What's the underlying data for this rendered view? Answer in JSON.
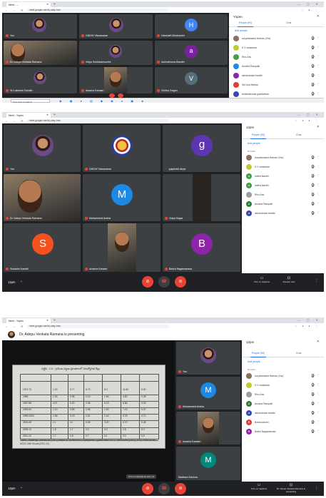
{
  "shot1": {
    "tab_title": "Meet - ...",
    "url": "meet.google.com/bj-ukay-hxw",
    "tiles": [
      {
        "name": "You",
        "kind": "photo"
      },
      {
        "name": "GNDW Viswanaran",
        "kind": "photo"
      },
      {
        "name": "Harshath Deshmukh",
        "kind": "letter",
        "letter": "H",
        "color": "#4285f4"
      },
      {
        "name": "Dr. Adepu Venkata Ramana",
        "kind": "video"
      },
      {
        "name": "Vidya Sekharamoorthi",
        "kind": "photo"
      },
      {
        "name": "Ashhathuma Bandhi",
        "kind": "letter",
        "letter": "a",
        "color": "#7b1fa2"
      },
      {
        "name": "Sri Lakshmi Gandhi",
        "kind": "photo"
      },
      {
        "name": "Anasha Kansari",
        "kind": "video"
      },
      {
        "name": "Vinitha Gagan",
        "kind": "letter",
        "letter": "V",
        "color": "#546e7a"
      }
    ],
    "meeting_time": "",
    "panel": {
      "title": "Yspen",
      "tab_people": "People (90)",
      "tab_chat": "Chat",
      "add_people": "Add people",
      "participants": [
        {
          "name": "suryadarsana thomas (You)",
          "color": "#8d6e63"
        },
        {
          "name": "K V vandanaa",
          "color": "#c0ca33"
        },
        {
          "name": "Rinu Anu",
          "color": "#43a047"
        },
        {
          "name": "Anusha Rampalli",
          "color": "#1e88e5"
        },
        {
          "name": "ashokumaar bandhi",
          "color": "#8e24aa"
        },
        {
          "name": "Sai Lisa Mahaa",
          "color": "#e53935"
        },
        {
          "name": "Ashwinikumar gaddubhan",
          "color": "#3949ab"
        }
      ]
    },
    "taskbar_search": "Type here to search"
  },
  "shot2": {
    "tab_title": "Meet - Yspen",
    "url": "meet.google.com/bj-ukay-hxw",
    "tiles": [
      {
        "name": "You",
        "kind": "photo"
      },
      {
        "name": "GNDW Viswanaran",
        "kind": "emblem"
      },
      {
        "name": "gujuluddi divya",
        "kind": "letter",
        "letter": "g",
        "color": "#5e35b1"
      },
      {
        "name": "Dr. Adepu Venkata Ramana",
        "kind": "video"
      },
      {
        "name": "Mohammed Arshia",
        "kind": "letter",
        "letter": "M",
        "color": "#1e88e5"
      },
      {
        "name": "Vidya Sagar",
        "kind": "dark"
      },
      {
        "name": "Suhasini Kandhi",
        "kind": "letter",
        "letter": "S",
        "color": "#f4511e"
      },
      {
        "name": "Anasha Kansari",
        "kind": "video"
      },
      {
        "name": "Badra Nagamanasa",
        "kind": "letter",
        "letter": "B",
        "color": "#8e24aa"
      }
    ],
    "meeting_time": "12pm",
    "panel": {
      "title": "12pm",
      "tab_people": "People (90)",
      "tab_chat": "Chat",
      "add_people": "Add people",
      "in_call": "IN CALL",
      "participants": [
        {
          "name": "suryadarsana thomas (You)",
          "color": "#8d6e63",
          "initial": ""
        },
        {
          "name": "K V vandanaa",
          "color": "#c0ca33",
          "initial": ""
        },
        {
          "name": "anitha kandhi",
          "color": "#43a047",
          "initial": "a"
        },
        {
          "name": "anitha kandhi",
          "color": "#43a047",
          "initial": "a"
        },
        {
          "name": "Rinu Anu",
          "color": "#9e9e9e",
          "initial": ""
        },
        {
          "name": "Anusha Rampalli",
          "color": "#2e7d32",
          "initial": "A"
        },
        {
          "name": "ashokumaar bandhi",
          "color": "#3949ab",
          "initial": "a"
        }
      ]
    },
    "controls": {
      "captions": "Turn on captions",
      "present": "Present now"
    }
  },
  "shot3": {
    "tab_title": "Meet - Yspen",
    "url": "meet.google.com/bj-ukay-hxw",
    "banner": "Dr. Adepu Venkata Ramana is presenting",
    "document": {
      "heading": "పట్టిక - 2.6 : గ్రామీణ పట్టణ ప్రాంతాలలో నిరుద్యోగిత రేట్లు",
      "rows": [
        [
          "1972-73",
          "1.20",
          "0.77",
          "6.73",
          "8.3",
          "11.84",
          "0.50"
        ],
        [
          "1983",
          "1.93",
          "0.96",
          "2.19",
          "1.84",
          "4.82",
          "0.28"
        ],
        [
          "1987-88",
          "4.07",
          "0.20",
          "2.55",
          "5.23",
          "6.86",
          "0.09"
        ],
        [
          "1993-94",
          "1.10",
          "0.55",
          "2.56",
          "1.63",
          "7.43",
          "0.67"
        ],
        [
          "1999-2000",
          "1.96",
          "0.23",
          "2.61",
          "1.44",
          "5.78",
          "0.71"
        ],
        [
          "2004-05",
          "2.1",
          "3.1",
          "0.06",
          "3.20",
          "6.70",
          "0.28"
        ],
        [
          "2009-10",
          "1.5",
          "1.7",
          "0.2",
          "0.3",
          "2.8",
          "0.3"
        ],
        [
          "2011-12",
          "1.7",
          "1.8",
          "0.7",
          "3.1",
          "3.3",
          "0.6"
        ]
      ],
      "footer": "ఆధారం : Planning Commission (2001) Report of Taskforce on Employment Opportunities NSSO 38th Round (1983), NSSO 50th Round, NSSO 66th Round (2011-12)."
    },
    "tiles": [
      {
        "name": "You",
        "kind": "photo"
      },
      {
        "name": "Mohammed Arshia",
        "kind": "letter",
        "letter": "M",
        "color": "#1e88e5"
      },
      {
        "name": "Anasha Kansari",
        "kind": "video"
      },
      {
        "name": "Madhavi Krishna",
        "kind": "letter",
        "letter": "M",
        "color": "#00897b"
      }
    ],
    "meeting_time": "12pm",
    "toast": "Turn on microphone (ctrl + d)",
    "panel": {
      "title": "12pm",
      "tab_people": "People (90)",
      "tab_chat": "Chat",
      "add_people": "Add people",
      "in_call": "IN CALL",
      "participants": [
        {
          "name": "suryadarsana thomas (You)",
          "color": "#8d6e63",
          "initial": ""
        },
        {
          "name": "K V vandanaa",
          "color": "#c0ca33",
          "initial": ""
        },
        {
          "name": "Rinu Anu",
          "color": "#9e9e9e",
          "initial": ""
        },
        {
          "name": "Anusha Rampalli",
          "color": "#2e7d32",
          "initial": "A"
        },
        {
          "name": "ashokumaar bandhi",
          "color": "#3949ab",
          "initial": "a"
        },
        {
          "name": "Banta bandhi",
          "color": "#e53935",
          "initial": "B"
        },
        {
          "name": "Badra Nagamanasa",
          "color": "#8e24aa",
          "initial": "B"
        }
      ]
    },
    "controls": {
      "captions": "Turn on captions",
      "present": "Dr. Adepu Venkata Ramana is presenting"
    }
  },
  "colors": {
    "accent": "#1a73e8",
    "hangup": "#ea4335",
    "stage": "#202124",
    "tile": "#3c4043"
  }
}
